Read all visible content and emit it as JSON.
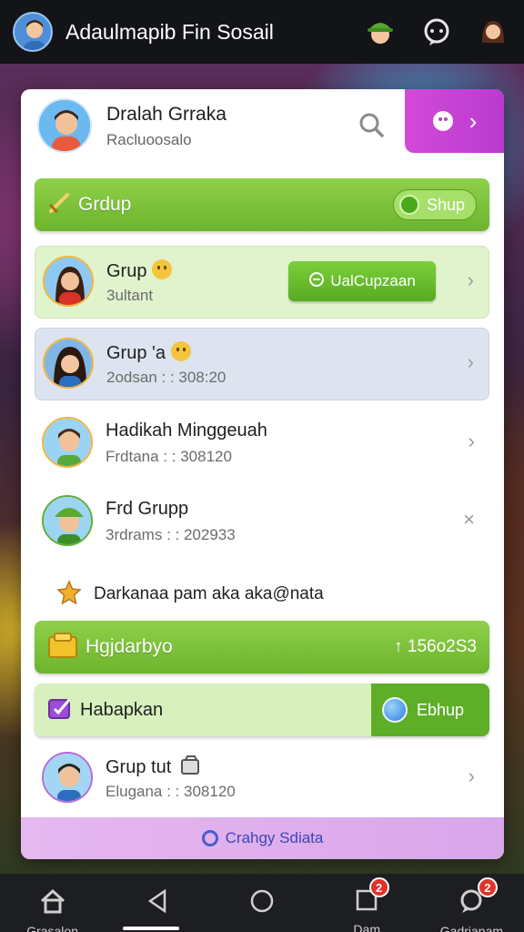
{
  "header": {
    "title": "Adaulmapib Fin Sosail",
    "icons": [
      "user-avatar-icon",
      "green-hat-avatar-icon",
      "chat-bubble-icon",
      "profile-avatar-icon"
    ]
  },
  "profile": {
    "name": "Dralah Grraka",
    "subtitle": "Racluoosalo",
    "icons": [
      "search-icon",
      "smiley-icon",
      "chevron-right-icon"
    ]
  },
  "group_banner": {
    "label": "Grdup",
    "button_label": "Shup",
    "icon": "sword-icon"
  },
  "list": [
    {
      "name": "Grup",
      "sub": "3ultant",
      "action": "UalCupzaan",
      "chevron": "›",
      "tint": "green"
    },
    {
      "name": "Grup 'a",
      "sub": "2odsan : : 308:20",
      "chevron": "›",
      "tint": "blue"
    },
    {
      "name": "Hadikah Minggeuah",
      "sub": "Frdtana : : 308120",
      "chevron": "›",
      "tint": "none"
    },
    {
      "name": "Frd Grupp",
      "sub": "3rdrams : : 202933",
      "chevron": "×",
      "tint": "none"
    }
  ],
  "notice": {
    "text": "Darkanaa pam aka aka@nata",
    "icon": "star-icon"
  },
  "highlight_bar": {
    "label": "Hgjdarbyo",
    "value": "↑ 156o2S3",
    "icon": "gold-bars-icon"
  },
  "help_bar": {
    "label": "Habapkan",
    "button_label": "Ebhup",
    "icon": "ticket-icon"
  },
  "last_row": {
    "name": "Grup tut",
    "sub": "Elugana : : 308120",
    "chevron": "›"
  },
  "footer": {
    "label": "Crahgy Sdiata",
    "icon": "ring-icon"
  },
  "nav": {
    "items": [
      {
        "label": "Grasalon",
        "icon": "home-icon"
      },
      {
        "label": "",
        "icon": "back-icon"
      },
      {
        "label": "",
        "icon": "circle-home-icon"
      },
      {
        "label": "Dam",
        "icon": "square-icon",
        "badge": "2"
      },
      {
        "label": "Gadrianam",
        "icon": "chat-icon",
        "badge": "2"
      }
    ]
  },
  "colors": {
    "accent_green": "#6db42c",
    "accent_purple": "#c440d4",
    "badge_red": "#e3322b"
  }
}
